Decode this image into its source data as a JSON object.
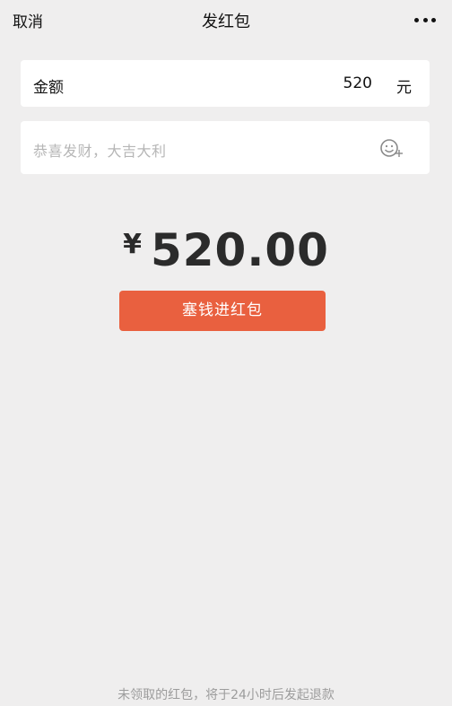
{
  "header": {
    "cancel_label": "取消",
    "title": "发红包"
  },
  "amount_field": {
    "label": "金额",
    "value": "520",
    "unit": "元"
  },
  "greeting_field": {
    "placeholder": "恭喜发财，大吉大利"
  },
  "total": {
    "currency_symbol": "¥",
    "value": "520.00"
  },
  "send_button_label": "塞钱进红包",
  "footer_note": "未领取的红包，将于24小时后发起退款",
  "colors": {
    "background": "#efeeee",
    "button": "#e9603f",
    "amount_text": "#2b2b2b",
    "placeholder": "#b6b6b6"
  },
  "icons": {
    "more": "more-dots-icon",
    "emoji": "emoji-add-icon"
  }
}
